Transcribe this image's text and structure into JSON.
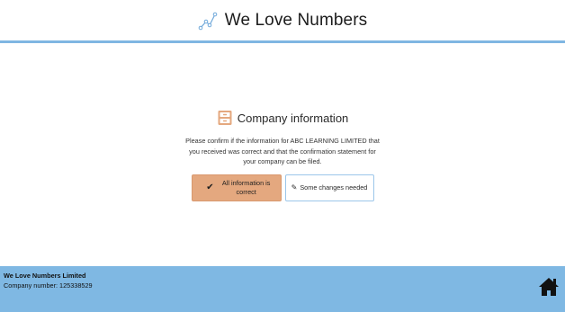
{
  "header": {
    "brand_name": "We Love Numbers",
    "logo_icon": "network-line-icon",
    "accent_color": "#7fb6e2"
  },
  "card": {
    "title": "Company information",
    "title_icon": "filing-cabinet-icon",
    "message": "Please confirm if the information for ABC LEARNING LIMITED that you received was correct and that the confirmation statement for your company can be filed.",
    "confirm_button": {
      "icon": "check-icon",
      "label": "All information is correct",
      "color": "#e4a87f"
    },
    "changes_button": {
      "icon": "pencil-icon",
      "label": "Some changes needed"
    }
  },
  "footer": {
    "company_name": "We Love Numbers Limited",
    "company_number_text": "Company number: 125338529",
    "home_icon": "home-icon",
    "background_color": "#7fb8e3"
  }
}
